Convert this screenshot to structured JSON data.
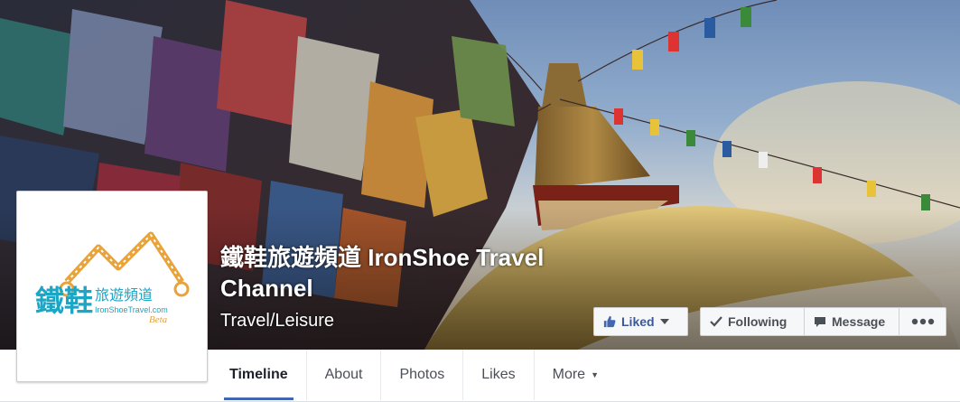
{
  "page": {
    "name": "鐵鞋旅遊頻道 IronShoe Travel Channel",
    "category": "Travel/Leisure"
  },
  "profile": {
    "logo_cjk": "鐵鞋",
    "logo_cjk_small": "旅遊頻道",
    "logo_domain": "IronShoeTravel.com",
    "logo_badge": "Beta"
  },
  "actions": {
    "liked": "Liked",
    "following": "Following",
    "message": "Message"
  },
  "tabs": [
    {
      "label": "Timeline",
      "active": true
    },
    {
      "label": "About"
    },
    {
      "label": "Photos"
    },
    {
      "label": "Likes"
    },
    {
      "label": "More"
    }
  ],
  "colors": {
    "accent": "#4267b2",
    "liked_text": "#3b5998",
    "logo_teal": "#1aa6c4",
    "logo_orange": "#e8a33a"
  }
}
